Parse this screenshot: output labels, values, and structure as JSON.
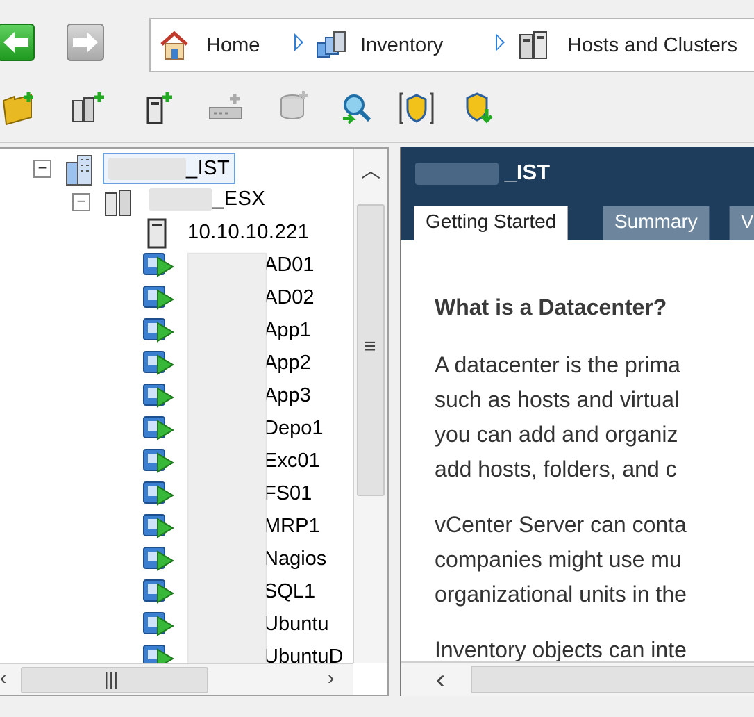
{
  "breadcrumb": {
    "items": [
      {
        "label": "Home",
        "icon": "home-icon"
      },
      {
        "label": "Inventory",
        "icon": "inventory-icon"
      },
      {
        "label": "Hosts and Clusters",
        "icon": "hosts-clusters-icon"
      }
    ]
  },
  "toolbar": {
    "icons": [
      "new-folder-icon",
      "new-cluster-icon",
      "add-host-icon",
      "add-switch-icon",
      "datastore-icon",
      "search-icon",
      "permissions-icon",
      "shield-download-icon"
    ]
  },
  "tree": {
    "datacenter_suffix": "_IST",
    "cluster_suffix": "_ESX",
    "host": "10.10.10.221",
    "vms": [
      "AD01",
      "AD02",
      "App1",
      "App2",
      "App3",
      "Depo1",
      "Exc01",
      "FS01",
      "MRP1",
      "Nagios",
      "SQL1",
      "Ubuntu",
      "UbuntuD"
    ]
  },
  "content": {
    "header_suffix": "_IST",
    "tabs": [
      "Getting Started",
      "Summary",
      "V"
    ],
    "heading": "What is a Datacenter?",
    "paragraphs": [
      [
        "A datacenter is the prima",
        "such as hosts and virtual",
        "you can add and organiz",
        "add hosts, folders, and c"
      ],
      [
        "vCenter Server can conta",
        "companies might use mu",
        "organizational units in the"
      ],
      [
        "Inventory objects can inte"
      ]
    ]
  },
  "colors": {
    "header_bg": "#1e3d5c",
    "tab_inactive": "#6d869e",
    "vm_green": "#38b838",
    "vm_blue": "#3a7fd0",
    "breadcrumb_arrow": "#2f7fd6"
  }
}
